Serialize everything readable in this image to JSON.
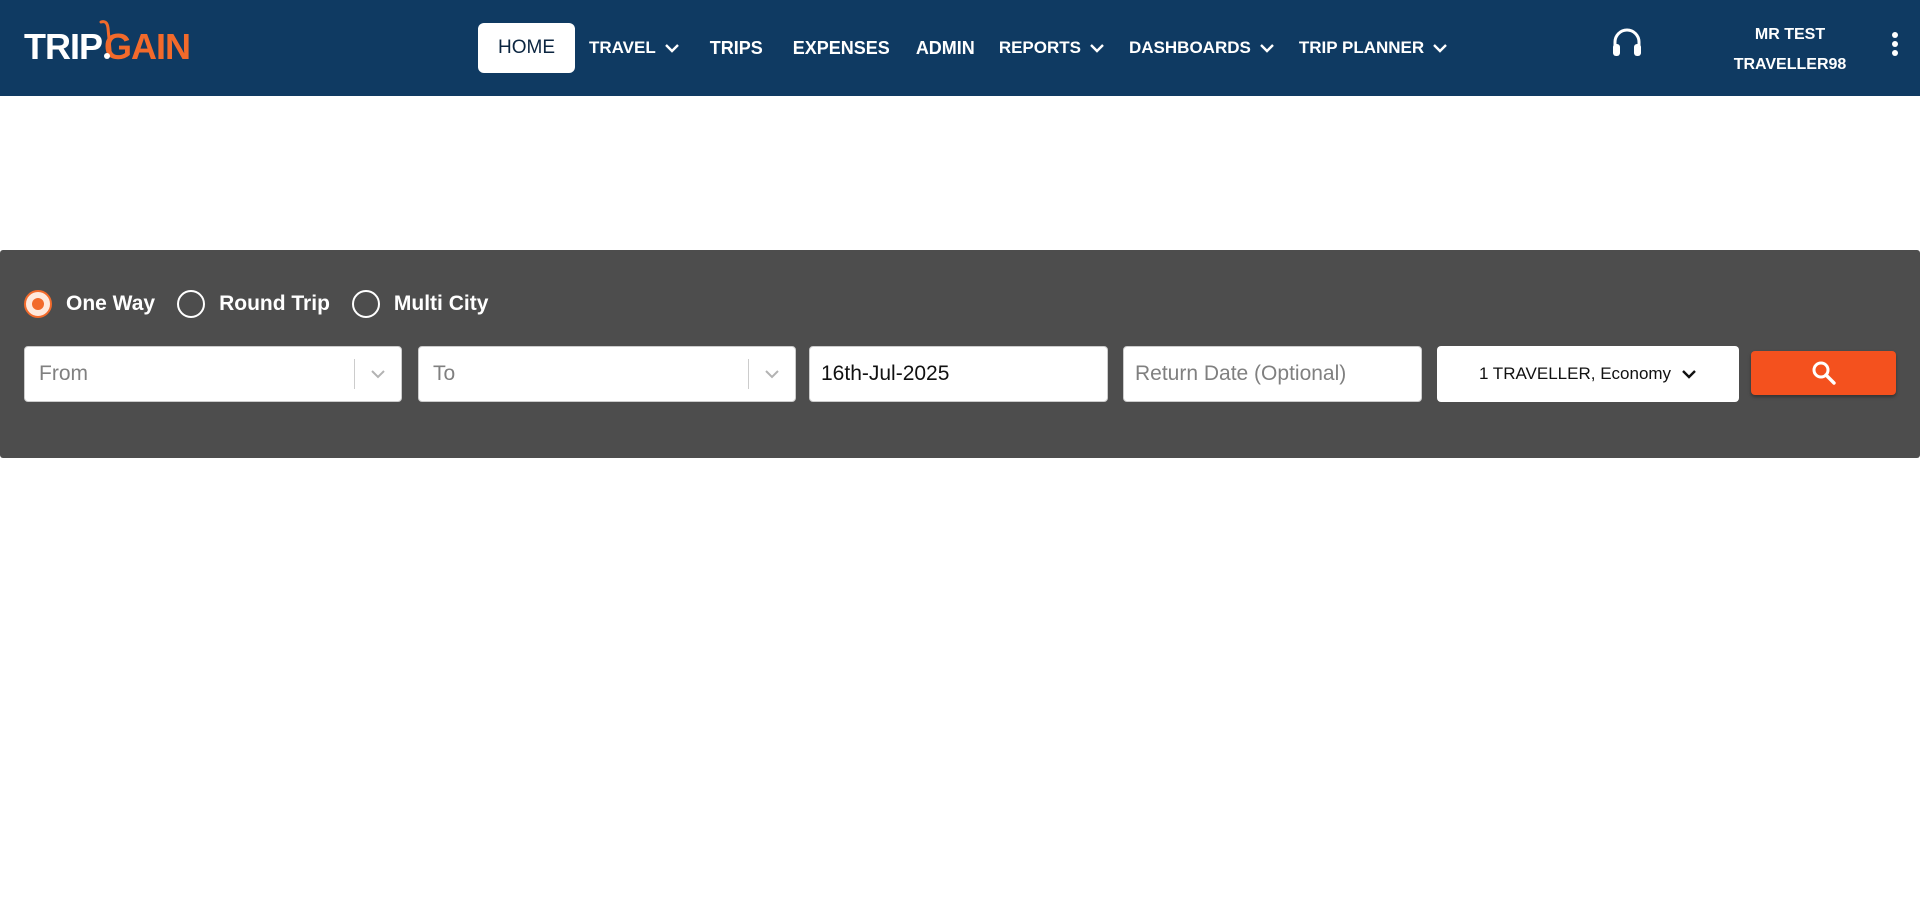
{
  "brand": {
    "logo_part1": "TRIP",
    "logo_part2": "GAIN",
    "accent": "#f26a2b",
    "navbar_bg": "#0f3a62"
  },
  "nav": {
    "items": [
      {
        "label": "HOME",
        "active": true,
        "dropdown": false
      },
      {
        "label": "TRAVEL",
        "active": false,
        "dropdown": true
      },
      {
        "label": "TRIPS",
        "active": false,
        "dropdown": false
      },
      {
        "label": "EXPENSES",
        "active": false,
        "dropdown": false
      },
      {
        "label": "ADMIN",
        "active": false,
        "dropdown": false
      },
      {
        "label": "REPORTS",
        "active": false,
        "dropdown": true
      },
      {
        "label": "DASHBOARDS",
        "active": false,
        "dropdown": true
      },
      {
        "label": "TRIP PLANNER",
        "active": false,
        "dropdown": true
      }
    ]
  },
  "header_right": {
    "support_icon": "headset-icon",
    "user_line1": "MR TEST",
    "user_line2": "TRAVELLER98",
    "menu_icon": "kebab-menu-icon"
  },
  "search": {
    "panel_bg": "#4d4d4d",
    "trip_types": [
      {
        "label": "One Way",
        "selected": true
      },
      {
        "label": "Round Trip",
        "selected": false
      },
      {
        "label": "Multi City",
        "selected": false
      }
    ],
    "from_placeholder": "From",
    "to_placeholder": "To",
    "depart_date_value": "16th-Jul-2025",
    "return_date_placeholder": "Return Date (Optional)",
    "traveller_label": "1 TRAVELLER, Economy",
    "search_icon": "search-icon",
    "search_button_color": "#f4511e"
  }
}
